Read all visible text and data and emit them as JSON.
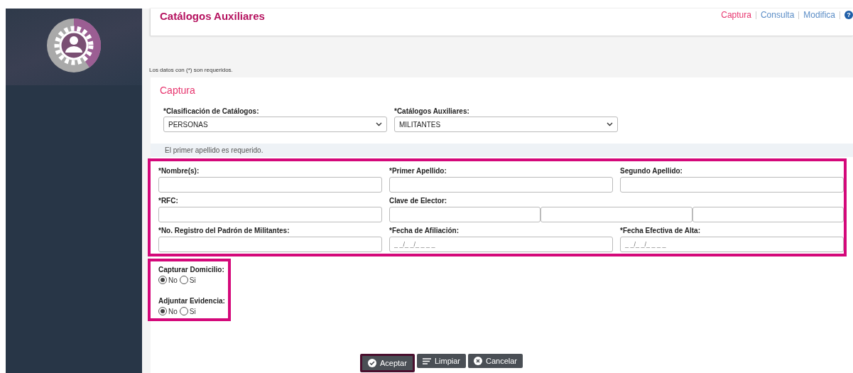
{
  "header": {
    "title": "Catálogos Auxiliares",
    "nav": [
      {
        "label": "Captura",
        "selected": true
      },
      {
        "label": "Consulta",
        "selected": false
      },
      {
        "label": "Modifica",
        "selected": false
      }
    ],
    "help": "?"
  },
  "required_note": "Los datos con (*) son requeridos.",
  "section_title": "Captura",
  "selects": [
    {
      "label": "*Clasificación de Catálogos:",
      "value": "PERSONAS"
    },
    {
      "label": "*Catálogos Auxiliares:",
      "value": "MILITANTES"
    }
  ],
  "alert": "El primer apellido es requerido.",
  "fields": [
    {
      "label": "*Nombre(s):",
      "kind": "text"
    },
    {
      "label": "*Primer Apellido:",
      "kind": "text"
    },
    {
      "label": "Segundo Apellido:",
      "kind": "text"
    },
    {
      "label": "*RFC:",
      "kind": "text"
    },
    {
      "label": "Clave de Elector:",
      "kind": "split"
    },
    {
      "label": "*No. Registro del Padrón de Militantes:",
      "kind": "text"
    },
    {
      "label": "*Fecha de Afiliación:",
      "kind": "date",
      "placeholder": "_ _/_ _/_ _ _ _"
    },
    {
      "label": "*Fecha Efectiva de Alta:",
      "kind": "date",
      "placeholder": "_ _/_ _/_ _ _ _"
    }
  ],
  "radio_groups": [
    {
      "label": "Capturar Domicilio:",
      "options": [
        {
          "label": "No",
          "selected": true
        },
        {
          "label": "Si",
          "selected": false
        }
      ]
    },
    {
      "label": "Adjuntar Evidencia:",
      "options": [
        {
          "label": "No",
          "selected": true
        },
        {
          "label": "Si",
          "selected": false
        }
      ]
    }
  ],
  "buttons": [
    {
      "label": "Aceptar",
      "kind": "accept",
      "highlighted": true
    },
    {
      "label": "Limpiar",
      "kind": "clear",
      "highlighted": false
    },
    {
      "label": "Cancelar",
      "kind": "cancel",
      "highlighted": false
    }
  ]
}
